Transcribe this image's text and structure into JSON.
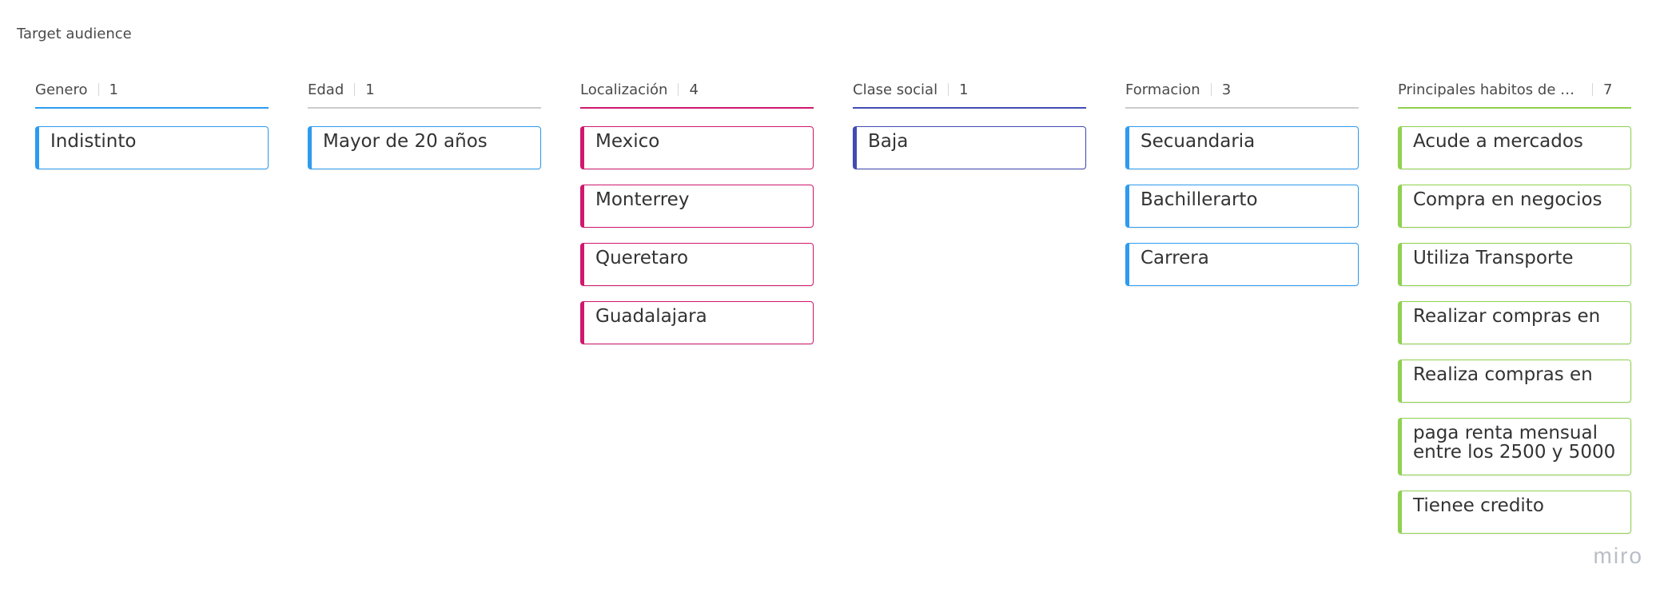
{
  "board": {
    "title": "Target audience",
    "brand": "miro"
  },
  "columns": [
    {
      "title": "Genero",
      "count": "1",
      "color": "#2d9bf0",
      "header_line": "#2d9bf0",
      "cards": [
        "Indistinto"
      ]
    },
    {
      "title": "Edad",
      "count": "1",
      "color": "#2d9bf0",
      "header_line": "#cccccc",
      "cards": [
        "Mayor de 20 años"
      ]
    },
    {
      "title": "Localización",
      "count": "4",
      "color": "#d0186e",
      "header_line": "#d0186e",
      "cards": [
        "Mexico",
        "Monterrey",
        "Queretaro",
        "Guadalajara"
      ]
    },
    {
      "title": "Clase social",
      "count": "1",
      "color": "#414bb2",
      "header_line": "#414bb2",
      "cards": [
        "Baja"
      ]
    },
    {
      "title": "Formacion",
      "count": "3",
      "color": "#2d9bf0",
      "header_line": "#cccccc",
      "cards": [
        "Secuandaria",
        "Bachillerarto",
        "Carrera"
      ]
    },
    {
      "title": "Principales habitos de co...",
      "count": "7",
      "color": "#8fd14f",
      "header_line": "#8fd14f",
      "cards": [
        "Acude a mercados",
        "Compra en negocios",
        "Utiliza Transporte",
        "Realizar compras en",
        "Realiza compras en",
        "paga renta mensual entre los 2500 y 5000",
        "Tienee credito"
      ]
    }
  ]
}
